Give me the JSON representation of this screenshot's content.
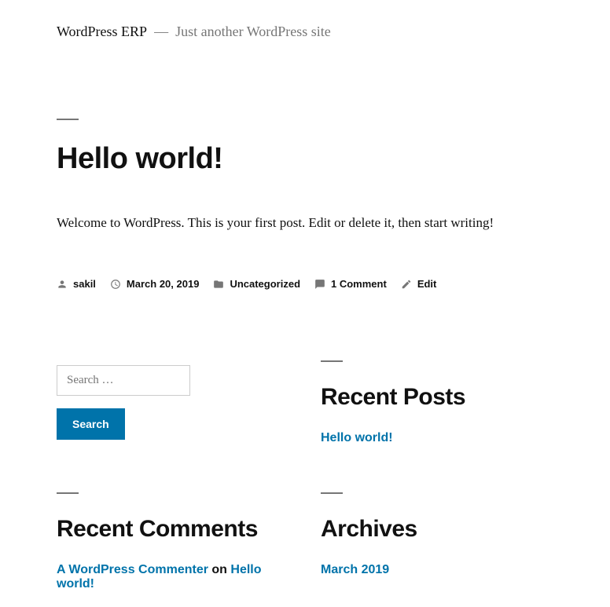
{
  "header": {
    "site_title": "WordPress ERP",
    "separator": "—",
    "tagline": "Just another WordPress site"
  },
  "post": {
    "title": "Hello world!",
    "content": "Welcome to WordPress. This is your first post. Edit or delete it, then start writing!",
    "meta": {
      "author": "sakil",
      "date": "March 20, 2019",
      "category": "Uncategorized",
      "comments": "1 Comment",
      "edit": "Edit"
    }
  },
  "widgets": {
    "search": {
      "placeholder": "Search …",
      "button": "Search"
    },
    "recent_posts": {
      "title": "Recent Posts",
      "items": [
        "Hello world!"
      ]
    },
    "recent_comments": {
      "title": "Recent Comments",
      "items": [
        {
          "author": "A WordPress Commenter",
          "on": "on",
          "post": "Hello world!"
        }
      ]
    },
    "archives": {
      "title": "Archives",
      "items": [
        "March 2019"
      ]
    }
  }
}
